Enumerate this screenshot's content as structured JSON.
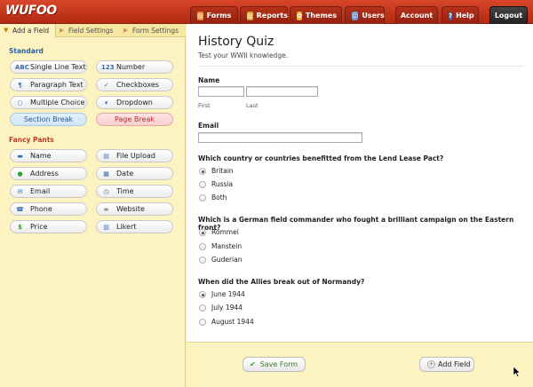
{
  "app": {
    "logo": "WUFOO"
  },
  "nav": {
    "forms": "Forms",
    "reports": "Reports",
    "themes": "Themes",
    "users": "Users",
    "account": "Account",
    "help": "Help",
    "logout": "Logout"
  },
  "sidebar": {
    "tabs": [
      "Add a Field",
      "Field Settings",
      "Form Settings"
    ],
    "standard_title": "Standard",
    "standard": [
      {
        "label": "Single Line Text",
        "icon": "ABC"
      },
      {
        "label": "Number",
        "icon": "123"
      },
      {
        "label": "Paragraph Text",
        "icon": "¶"
      },
      {
        "label": "Checkboxes",
        "icon": "✓"
      },
      {
        "label": "Multiple Choice",
        "icon": "○"
      },
      {
        "label": "Dropdown",
        "icon": "▾"
      },
      {
        "label": "Section Break",
        "icon": ""
      },
      {
        "label": "Page Break",
        "icon": ""
      }
    ],
    "fancy_title": "Fancy Pants",
    "fancy": [
      {
        "label": "Name",
        "icon": "▬"
      },
      {
        "label": "File Upload",
        "icon": "▤"
      },
      {
        "label": "Address",
        "icon": "●"
      },
      {
        "label": "Date",
        "icon": "▦"
      },
      {
        "label": "Email",
        "icon": "✉"
      },
      {
        "label": "Time",
        "icon": "◷"
      },
      {
        "label": "Phone",
        "icon": "☎"
      },
      {
        "label": "Website",
        "icon": "∞"
      },
      {
        "label": "Price",
        "icon": "$"
      },
      {
        "label": "Likert",
        "icon": "▥"
      }
    ]
  },
  "form": {
    "title": "History Quiz",
    "description": "Test your WWII knowledge.",
    "name_label": "Name",
    "first_label": "First",
    "last_label": "Last",
    "email_label": "Email",
    "questions": [
      {
        "text": "Which country or countries benefitted from the Lend Lease Pact?",
        "options": [
          "Britain",
          "Russia",
          "Both"
        ],
        "selected": 0
      },
      {
        "text": "Which is a German field commander who fought a brilliant campaign on the Eastern front?",
        "options": [
          "Rommel",
          "Manstein",
          "Guderian"
        ],
        "selected": 0
      },
      {
        "text": "When did the Allies break out of Normandy?",
        "options": [
          "June 1944",
          "July 1944",
          "August 1944"
        ],
        "selected": 0
      }
    ]
  },
  "footer": {
    "save_label": "Save Form",
    "add_label": "Add Field"
  },
  "colors": {
    "header_red": "#c7381d",
    "sidebar_yellow": "#fdf3c0",
    "standard_blue": "#2a63a8",
    "fancy_red": "#c0392b"
  }
}
